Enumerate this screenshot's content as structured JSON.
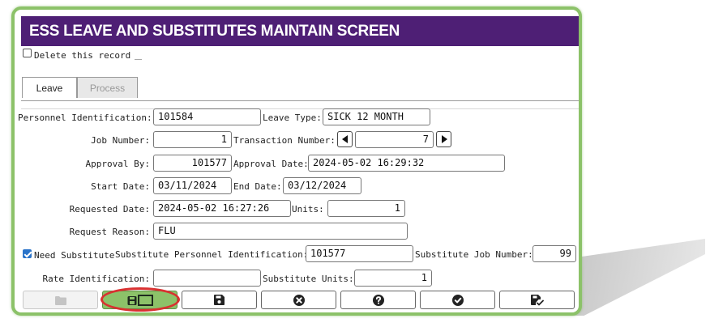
{
  "window": {
    "title": "ESS LEAVE AND SUBSTITUTES MAINTAIN SCREEN"
  },
  "delete_record": {
    "label": "Delete this record",
    "checked": false
  },
  "tabs": [
    {
      "label": "Leave",
      "active": true
    },
    {
      "label": "Process",
      "active": false
    }
  ],
  "form": {
    "personnel_id": {
      "label": "Personnel Identification:",
      "value": "101584"
    },
    "leave_type": {
      "label": "Leave Type:",
      "value": "SICK 12 MONTH"
    },
    "job_number": {
      "label": "Job Number:",
      "value": "1"
    },
    "transaction_number": {
      "label": "Transaction Number:",
      "value": "7"
    },
    "approval_by": {
      "label": "Approval By:",
      "value": "101577"
    },
    "approval_date": {
      "label": "Approval Date:",
      "value": "2024-05-02 16:29:32"
    },
    "start_date": {
      "label": "Start Date:",
      "value": "03/11/2024"
    },
    "end_date": {
      "label": "End Date:",
      "value": "03/12/2024"
    },
    "requested_date": {
      "label": "Requested Date:",
      "value": "2024-05-02 16:27:26"
    },
    "units": {
      "label": "Units:",
      "value": "1"
    },
    "request_reason": {
      "label": "Request Reason:",
      "value": "FLU"
    },
    "need_substitute": {
      "label": "Need Substitute",
      "checked": true
    },
    "sub_personnel_id": {
      "label": "Substitute Personnel Identification:",
      "value": "101577"
    },
    "sub_job_number": {
      "label": "Substitute Job Number:",
      "value": "99"
    },
    "rate_id": {
      "label": "Rate Identification:",
      "value": ""
    },
    "sub_units": {
      "label": "Substitute Units:",
      "value": "1"
    }
  },
  "toolbar": {
    "buttons": [
      {
        "icon": "folder-icon",
        "disabled": true
      },
      {
        "icon": "save-as-new-icon",
        "highlighted": true
      },
      {
        "icon": "floppy-disk-icon"
      },
      {
        "icon": "cancel-circle-icon"
      },
      {
        "icon": "help-circle-icon"
      },
      {
        "icon": "check-circle-icon"
      },
      {
        "icon": "save-check-icon"
      }
    ]
  },
  "colors": {
    "title_bg": "#4e1f75",
    "frame_border": "#8cc269",
    "highlight_ring": "#d93131",
    "checkbox_checked": "#2a73c9"
  }
}
